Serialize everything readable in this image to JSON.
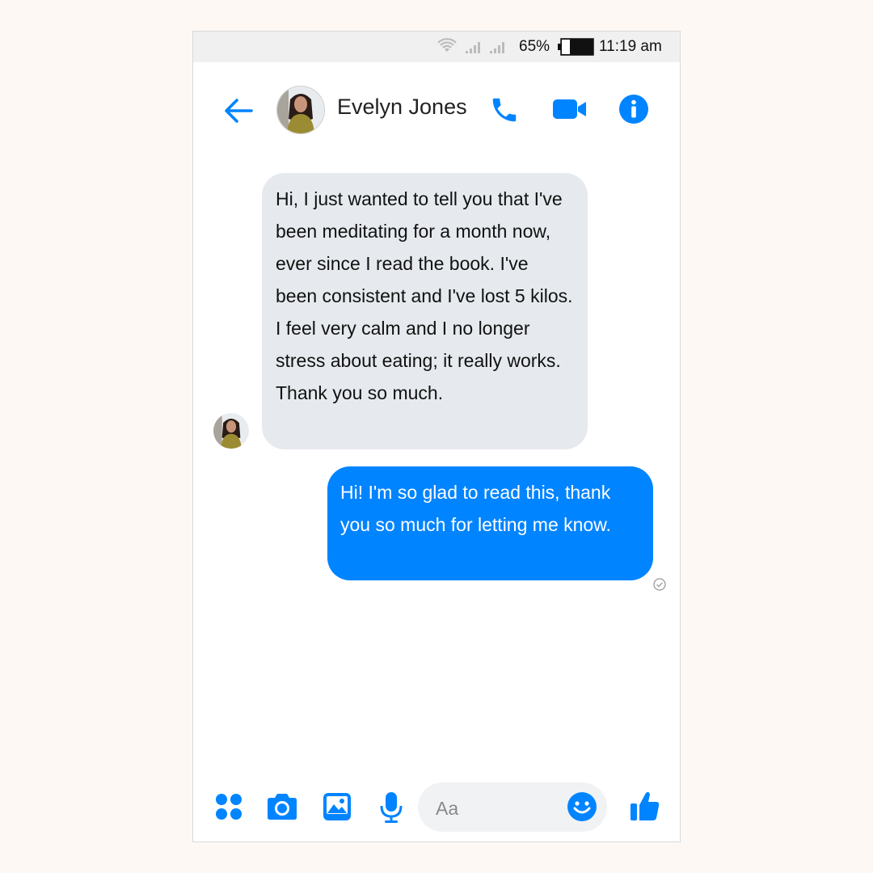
{
  "status_bar": {
    "battery_percent": "65%",
    "time": "11:19 am"
  },
  "header": {
    "contact_name": "Evelyn Jones"
  },
  "messages": [
    {
      "direction": "incoming",
      "text": "Hi, I just wanted to tell you that I've been meditating for a month now, ever since I read the book. I've been consistent and I've lost 5 kilos. I feel very calm and I no longer stress about eating; it really works. Thank you so much."
    },
    {
      "direction": "outgoing",
      "text": "Hi! I'm so glad to read this, thank you so much for letting me know."
    }
  ],
  "composer": {
    "placeholder": "Aa"
  },
  "icons": {
    "back": "back-arrow-icon",
    "call": "phone-icon",
    "video": "video-camera-icon",
    "info": "info-icon",
    "apps": "apps-grid-icon",
    "camera": "camera-icon",
    "gallery": "image-icon",
    "mic": "microphone-icon",
    "emoji": "emoji-icon",
    "like": "thumbs-up-icon",
    "delivered": "delivered-check-icon"
  },
  "colors": {
    "accent": "#0084ff",
    "incoming_bubble": "#e6eaee",
    "status_bar": "#f0f0f0",
    "page_background": "#fdf8f4"
  }
}
